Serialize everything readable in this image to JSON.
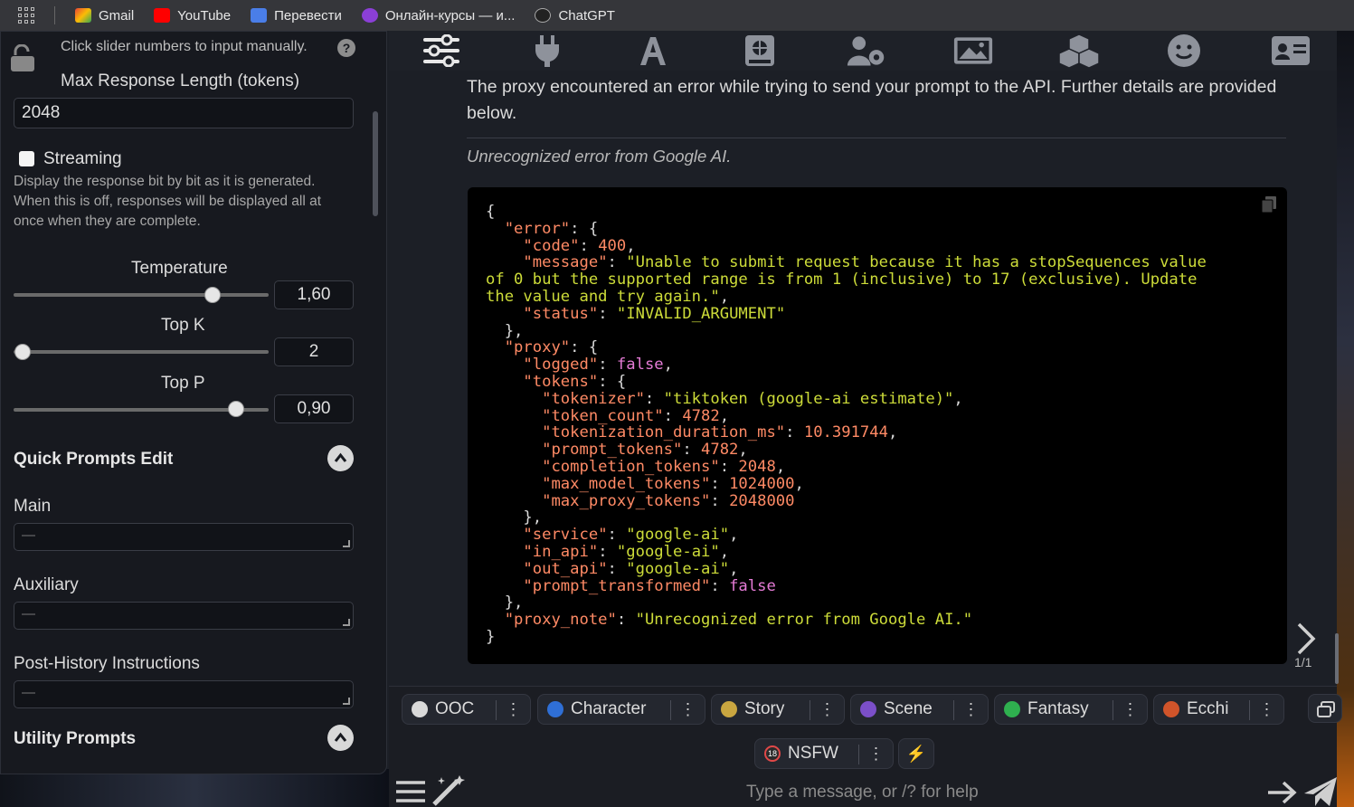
{
  "bookmarks": [
    {
      "label": "Gmail",
      "icon": "gmail-icon",
      "color": "#ea4335"
    },
    {
      "label": "YouTube",
      "icon": "youtube-icon",
      "color": "#ff0000"
    },
    {
      "label": "Перевести",
      "icon": "translate-icon",
      "color": "#4a7ee8"
    },
    {
      "label": "Онлайн-курсы — и...",
      "icon": "courses-icon",
      "color": "#8b3fd6"
    },
    {
      "label": "ChatGPT",
      "icon": "chatgpt-icon",
      "color": "#1a1a1a"
    }
  ],
  "left_panel": {
    "hint": "Click slider numbers to input manually.",
    "help": "?",
    "max_response_label": "Max Response Length (tokens)",
    "max_response_value": "2048",
    "streaming_label": "Streaming",
    "streaming_checked": false,
    "streaming_desc_1": "Display the response bit by bit as it is generated.",
    "streaming_desc_2": "When this is off, responses will be displayed all at once when they are complete.",
    "sliders": [
      {
        "label": "Temperature",
        "value": "1,60",
        "fraction": 0.78
      },
      {
        "label": "Top K",
        "value": "2",
        "fraction": 0.0
      },
      {
        "label": "Top P",
        "value": "0,90",
        "fraction": 0.9
      }
    ],
    "quick_prompts_title": "Quick Prompts Edit",
    "fields": [
      {
        "label": "Main",
        "value": "—"
      },
      {
        "label": "Auxiliary",
        "value": "—"
      },
      {
        "label": "Post-History Instructions",
        "value": "—"
      }
    ],
    "utility_prompts_title": "Utility Prompts"
  },
  "toolbar": {
    "icons": [
      "sliders-icon",
      "plug-icon",
      "font-icon",
      "book-globe-icon",
      "user-gear-icon",
      "image-icon",
      "cubes-icon",
      "smile-icon",
      "id-card-icon"
    ]
  },
  "message": {
    "text": "The proxy encountered an error while trying to send your prompt to the API. Further details are provided below.",
    "error_title": "Unrecognized error from Google AI.",
    "swipe_counter": "1/1"
  },
  "error_json": {
    "code": "400",
    "message": "\"Unable to submit request because it has a stopSequences value\nof 0 but the supported range is from 1 (inclusive) to 17 (exclusive). Update\nthe value and try again.\"",
    "status": "\"INVALID_ARGUMENT\"",
    "logged": "false",
    "tokenizer": "\"tiktoken (google-ai estimate)\"",
    "token_count": "4782",
    "tokenization_duration_ms": "10.391744",
    "prompt_tokens": "4782",
    "completion_tokens": "2048",
    "max_model_tokens": "1024000",
    "max_proxy_tokens": "2048000",
    "service": "\"google-ai\"",
    "in_api": "\"google-ai\"",
    "out_api": "\"google-ai\"",
    "prompt_transformed": "false",
    "proxy_note": "\"Unrecognized error from Google AI.\""
  },
  "chips": [
    {
      "label": "OOC",
      "color": "#d9d9d9"
    },
    {
      "label": "Character",
      "color": "#2f6fd6"
    },
    {
      "label": "Story",
      "color": "#c9a640"
    },
    {
      "label": "Scene",
      "color": "#7b4fc9"
    },
    {
      "label": "Fantasy",
      "color": "#2fb04f"
    },
    {
      "label": "Ecchi",
      "color": "#d0542a"
    }
  ],
  "nsfw_chip": {
    "label": "NSFW",
    "badge": "18"
  },
  "chip_menu": "⋮",
  "bolt": "⚡",
  "input": {
    "placeholder": "Type a message, or /? for help"
  }
}
